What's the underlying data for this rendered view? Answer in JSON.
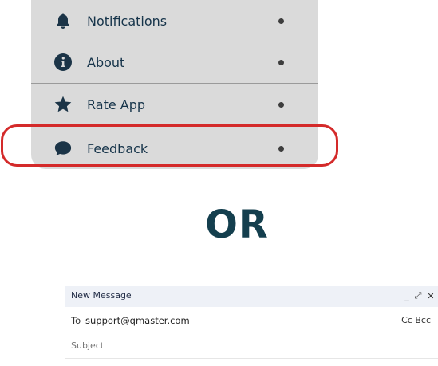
{
  "menu": {
    "items": [
      {
        "label": "Notifications",
        "icon": "bell-icon"
      },
      {
        "label": "About",
        "icon": "info-icon"
      },
      {
        "label": "Rate App",
        "icon": "star-icon"
      },
      {
        "label": "Feedback",
        "icon": "chat-bubble-icon"
      }
    ],
    "highlighted_item": "Feedback",
    "highlight_color": "#d42a2a",
    "icon_color": "#1b3447"
  },
  "separator_text": "OR",
  "compose": {
    "title": "New Message",
    "controls": {
      "minimize": "_",
      "expand": "⤢",
      "close": "✕"
    },
    "to_label": "To",
    "to_value": "support@qmaster.com",
    "cc_bcc": "Cc Bcc",
    "subject_placeholder": "Subject"
  }
}
